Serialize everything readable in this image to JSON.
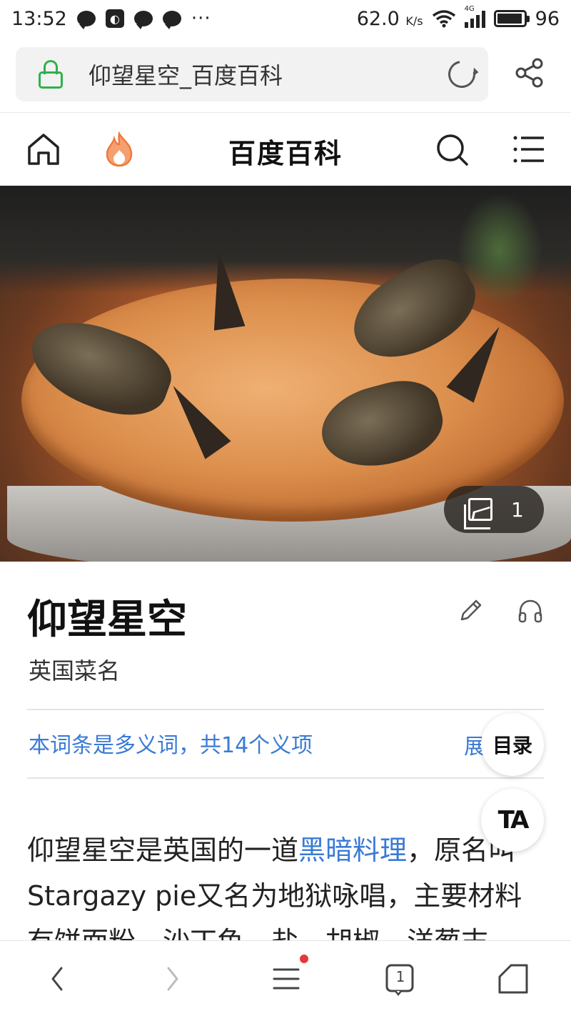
{
  "status_bar": {
    "time": "13:52",
    "network_speed": "62.0",
    "network_speed_unit": "K/s",
    "signal_label": "4G",
    "battery_level": "96",
    "battery_fraction": 0.96,
    "overflow_dots": "···"
  },
  "address_bar": {
    "page_title": "仰望星空_百度百科",
    "icons": [
      "lock-icon",
      "reload-icon",
      "share-icon"
    ]
  },
  "site_nav": {
    "title": "百度百科",
    "icons": [
      "home-icon",
      "fire-icon",
      "search-icon",
      "menu-icon"
    ],
    "accent_color": "#f08a4b"
  },
  "hero": {
    "image_count": "1",
    "icon": "gallery-icon"
  },
  "entry": {
    "title": "仰望星空",
    "subtitle": "英国菜名",
    "polysemy_text": "本词条是多义词，共14个义项",
    "expand_text": "展开",
    "body_prefix": "仰望星空是英国的一道",
    "body_link": "黑暗料理",
    "body_suffix": "，原名叫",
    "body_line2": "Stargazy pie又名为地狱咏唱，主要材料",
    "body_line3": "有饼面粉、沙丁鱼、盐、胡椒、洋葱末"
  },
  "floating_buttons": {
    "toc_label": "目录",
    "ta_label": "TA"
  },
  "bottom_nav": {
    "tab_count": "1",
    "icons": [
      "back-icon",
      "forward-icon",
      "menu-icon",
      "tabs-icon",
      "home-icon"
    ]
  },
  "colors": {
    "link": "#3a7bd5",
    "lock_green": "#2fb14c",
    "notification_red": "#e53935"
  }
}
